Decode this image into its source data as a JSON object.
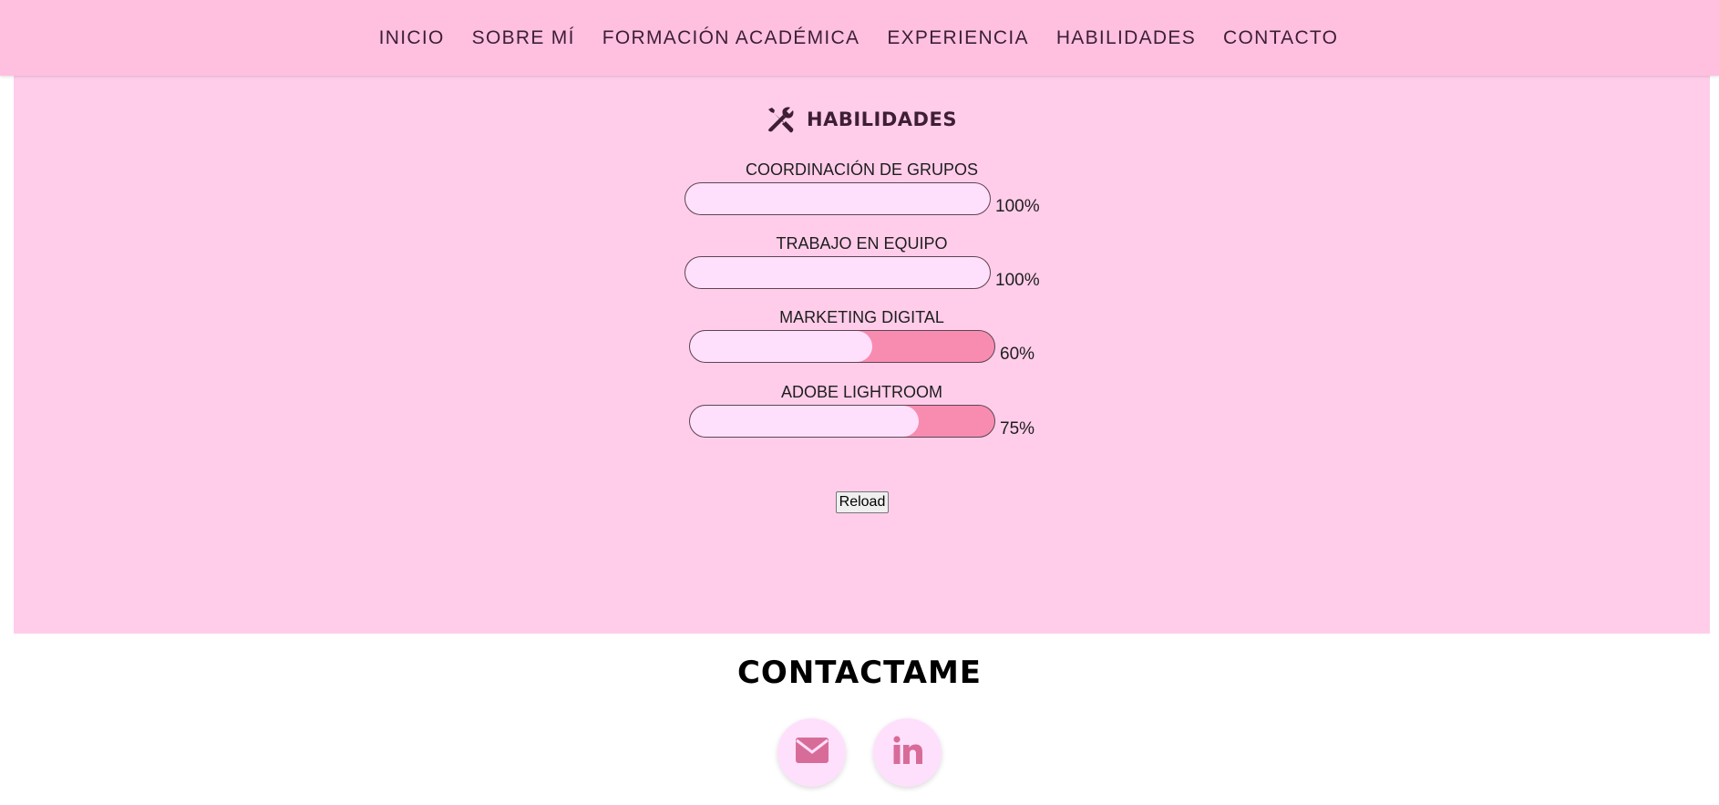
{
  "nav": {
    "items": [
      {
        "label": "INICIO"
      },
      {
        "label": "SOBRE MÍ"
      },
      {
        "label": "FORMACIÓN ACADÉMICA"
      },
      {
        "label": "EXPERIENCIA"
      },
      {
        "label": "HABILIDADES"
      },
      {
        "label": "CONTACTO"
      }
    ]
  },
  "skills": {
    "title": "HABILIDADES",
    "title_icon": "tools-icon",
    "items": [
      {
        "label": "COORDINACIÓN DE GRUPOS",
        "percent_text": "100%",
        "level": 100
      },
      {
        "label": "TRABAJO EN EQUIPO",
        "percent_text": "100%",
        "level": 100
      },
      {
        "label": "MARKETING DIGITAL",
        "percent_text": "60%",
        "level": 60
      },
      {
        "label": "ADOBE LIGHTROOM",
        "percent_text": "75%",
        "level": 75
      }
    ],
    "reload_label": "Reload"
  },
  "contact": {
    "title": "CONTACTAME",
    "links": [
      {
        "icon": "envelope-icon"
      },
      {
        "icon": "linkedin-icon"
      }
    ]
  },
  "colors": {
    "nav_bg": "#ffc0e0",
    "section_bg": "#ffcdea",
    "bar_track": "#f88cb0",
    "bar_fill": "#ffe0fc",
    "icon_accent": "#d86c98",
    "text_dark": "#3d1e35"
  }
}
